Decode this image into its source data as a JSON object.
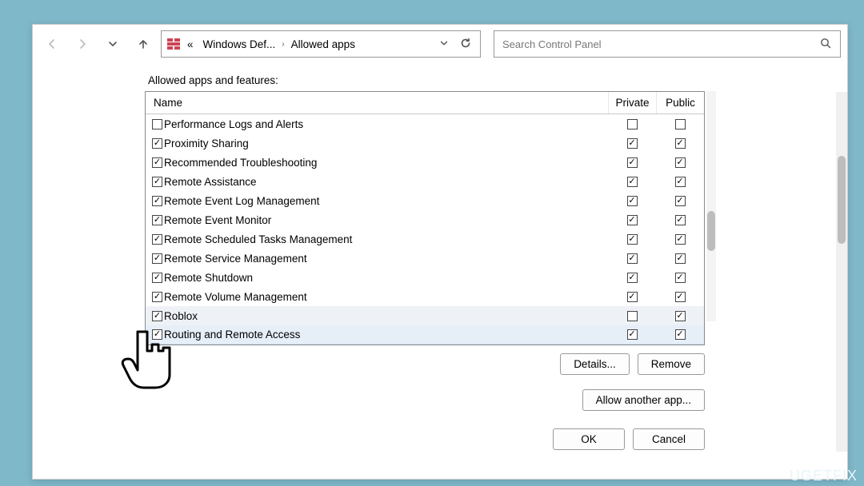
{
  "breadcrumb": {
    "prefix": "«",
    "part1": "Windows Def...",
    "part2": "Allowed apps"
  },
  "search": {
    "placeholder": "Search Control Panel"
  },
  "section_label": "Allowed apps and features:",
  "headers": {
    "name": "Name",
    "private": "Private",
    "public": "Public"
  },
  "rows": [
    {
      "name": "Performance Logs and Alerts",
      "enabled": false,
      "private": false,
      "public": false,
      "highlight": false
    },
    {
      "name": "Proximity Sharing",
      "enabled": true,
      "private": true,
      "public": true,
      "highlight": false
    },
    {
      "name": "Recommended Troubleshooting",
      "enabled": true,
      "private": true,
      "public": true,
      "highlight": false
    },
    {
      "name": "Remote Assistance",
      "enabled": true,
      "private": true,
      "public": true,
      "highlight": false
    },
    {
      "name": "Remote Event Log Management",
      "enabled": true,
      "private": true,
      "public": true,
      "highlight": false
    },
    {
      "name": "Remote Event Monitor",
      "enabled": true,
      "private": true,
      "public": true,
      "highlight": false
    },
    {
      "name": "Remote Scheduled Tasks Management",
      "enabled": true,
      "private": true,
      "public": true,
      "highlight": false
    },
    {
      "name": "Remote Service Management",
      "enabled": true,
      "private": true,
      "public": true,
      "highlight": false
    },
    {
      "name": "Remote Shutdown",
      "enabled": true,
      "private": true,
      "public": true,
      "highlight": false
    },
    {
      "name": "Remote Volume Management",
      "enabled": true,
      "private": true,
      "public": true,
      "highlight": false
    },
    {
      "name": "Roblox",
      "enabled": true,
      "private": false,
      "public": true,
      "highlight": true
    },
    {
      "name": "Routing and Remote Access",
      "enabled": true,
      "private": true,
      "public": true,
      "selected": true
    }
  ],
  "buttons": {
    "details": "Details...",
    "remove": "Remove",
    "allow_another": "Allow another app...",
    "ok": "OK",
    "cancel": "Cancel"
  },
  "watermark": "UGETFIX"
}
